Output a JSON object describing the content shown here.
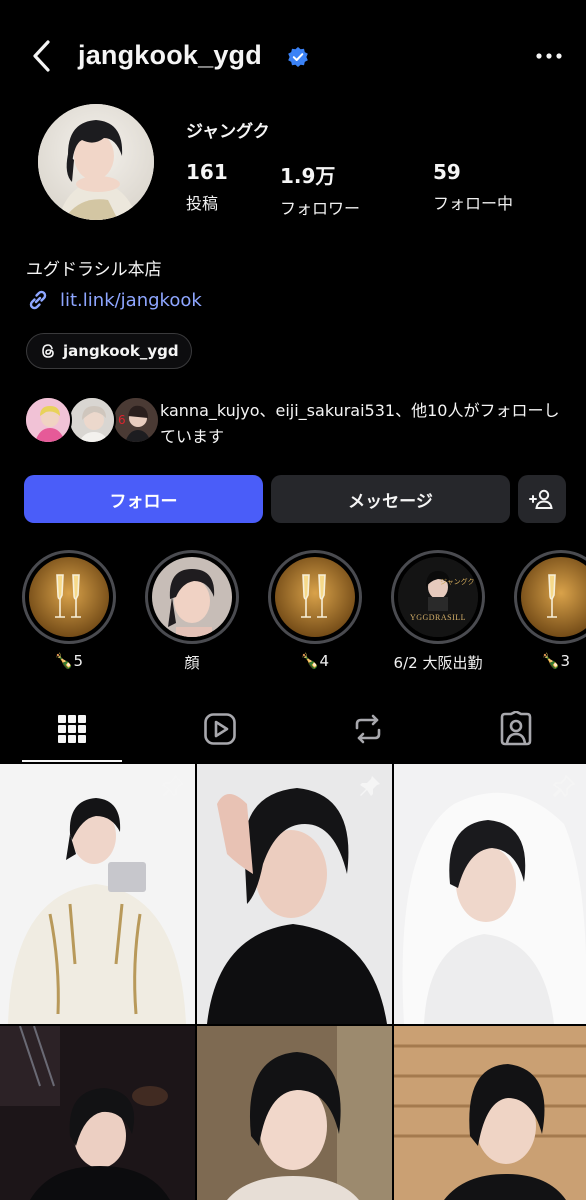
{
  "header": {
    "username": "jangkook_ygd",
    "back_icon": "chevron-left-icon",
    "verified_icon": "verified-badge-icon",
    "more_icon": "more-horizontal-icon"
  },
  "profile": {
    "display_name": "ジャングク",
    "stats": [
      {
        "value": "161",
        "label": "投稿"
      },
      {
        "value": "1.9万",
        "label": "フォロワー"
      },
      {
        "value": "59",
        "label": "フォロー中"
      }
    ],
    "bio": "ユグドラシル本店",
    "link": "lit.link/jangkook",
    "threads_handle": "jangkook_ygd"
  },
  "followed_by": {
    "text": "kanna_kujyo、eiji_sakurai531、他10人がフォローしています"
  },
  "actions": {
    "follow": "フォロー",
    "message": "メッセージ",
    "add_icon": "person-add-icon"
  },
  "highlights": [
    {
      "label": "🍾5",
      "kind": "champagne"
    },
    {
      "label": "顔",
      "kind": "face"
    },
    {
      "label": "🍾4",
      "kind": "champagne"
    },
    {
      "label": "6/2 大阪出勤",
      "kind": "poster"
    },
    {
      "label": "🍾3",
      "kind": "champagne"
    }
  ],
  "highlight_poster_text": {
    "name": "ジャングク",
    "title": "YGGDRASILL"
  },
  "tabs": [
    {
      "name": "grid",
      "icon": "grid-icon",
      "active": true
    },
    {
      "name": "reels",
      "icon": "reels-icon",
      "active": false
    },
    {
      "name": "reposts",
      "icon": "repost-icon",
      "active": false
    },
    {
      "name": "tagged",
      "icon": "tagged-person-icon",
      "active": false
    }
  ],
  "colors": {
    "background": "#000000",
    "accent": "#4a5df9",
    "link": "#8ea6ff",
    "button_secondary": "#26272b",
    "verified": "#3b82f6"
  }
}
